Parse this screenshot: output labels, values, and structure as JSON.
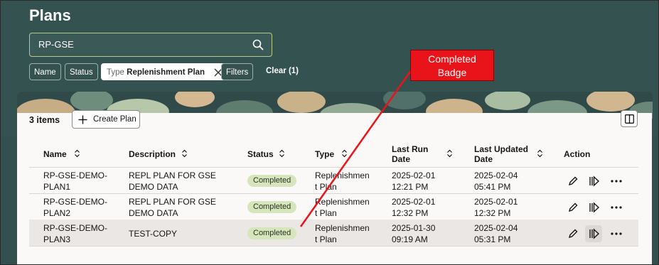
{
  "page": {
    "title": "Plans"
  },
  "search": {
    "value": "RP-GSE",
    "icon": "search-icon"
  },
  "filters": {
    "name_label": "Name",
    "status_label": "Status",
    "type_prefix": "Type",
    "type_value": "Replenishment Plan",
    "filters_label": "Filters",
    "clear_label": "Clear (1)"
  },
  "toolbar": {
    "count": "3 items",
    "create_label": "Create Plan"
  },
  "table": {
    "headers": {
      "name": "Name",
      "description": "Description",
      "status": "Status",
      "type": "Type",
      "last_run_1": "Last Run",
      "last_run_2": "Date",
      "last_updated_1": "Last Updated",
      "last_updated_2": "Date",
      "action": "Action"
    },
    "rows": [
      {
        "name_1": "RP-GSE-DEMO-",
        "name_2": "PLAN1",
        "desc_1": "REPL PLAN FOR GSE",
        "desc_2": "DEMO DATA",
        "status": "Completed",
        "type_1": "Replenishmen",
        "type_2": "t Plan",
        "run_1": "2025-02-01",
        "run_2": "12:21 PM",
        "upd_1": "2025-02-04",
        "upd_2": "05:41 PM"
      },
      {
        "name_1": "RP-GSE-DEMO-",
        "name_2": "PLAN2",
        "desc_1": "REPL PLAN FOR GSE",
        "desc_2": "DEMO DATA",
        "status": "Completed",
        "type_1": "Replenishmen",
        "type_2": "t Plan",
        "run_1": "2025-02-01",
        "run_2": "12:32 PM",
        "upd_1": "2025-02-01",
        "upd_2": "12:32 PM"
      },
      {
        "name_1": "RP-GSE-DEMO-",
        "name_2": "PLAN3",
        "desc_1": "TEST-COPY",
        "desc_2": "",
        "status": "Completed",
        "type_1": "Replenishmen",
        "type_2": "t Plan",
        "run_1": "2025-01-30",
        "run_2": "09:19 AM",
        "upd_1": "2025-02-04",
        "upd_2": "05:31 PM"
      }
    ]
  },
  "callout": {
    "line1": "Completed",
    "line2": "Badge"
  },
  "colors": {
    "header_bg": "#34524f",
    "badge_bg": "#d7e5bd",
    "callout_red": "#e8141a"
  }
}
